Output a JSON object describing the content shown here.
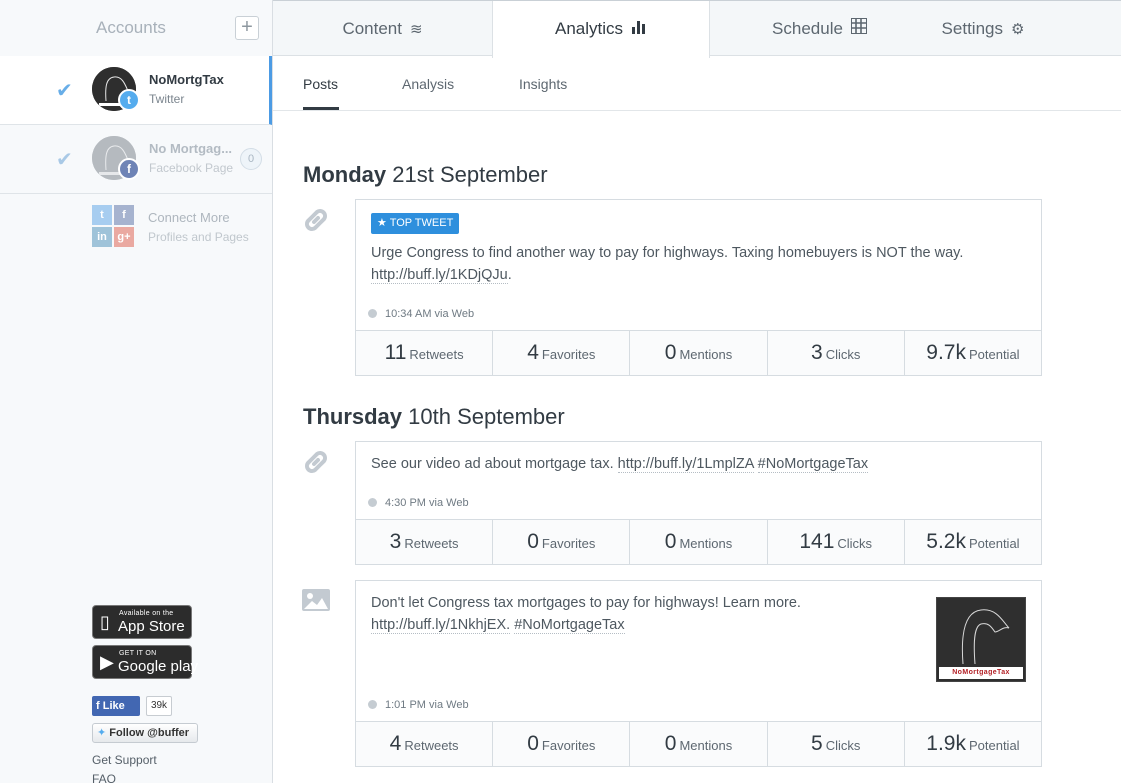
{
  "sidebar": {
    "title": "Accounts",
    "add_label": "+",
    "accounts": [
      {
        "name": "NoMortgTax",
        "type": "Twitter",
        "network": "t"
      },
      {
        "name": "No Mortgag...",
        "type": "Facebook Page",
        "network": "f",
        "count": "0"
      }
    ],
    "connect": {
      "title": "Connect More",
      "subtitle": "Profiles and Pages"
    },
    "app_store": {
      "small": "Available on the",
      "big": "App Store"
    },
    "google_play": {
      "small": "GET IT ON",
      "big": "Google play"
    },
    "fb_like": {
      "label": "Like",
      "count": "39k"
    },
    "tw_follow": {
      "label": "Follow @buffer"
    },
    "links": [
      "Get Support",
      "FAQ"
    ]
  },
  "topnav": {
    "tabs": [
      {
        "label": "Content",
        "icon": "layers-icon"
      },
      {
        "label": "Analytics",
        "icon": "bar-chart-icon"
      },
      {
        "label": "Schedule",
        "icon": "calendar-icon"
      },
      {
        "label": "Settings",
        "icon": "gear-icon"
      }
    ]
  },
  "subnav": {
    "tabs": [
      "Posts",
      "Analysis",
      "Insights"
    ]
  },
  "days": [
    {
      "day": "Monday",
      "date": "21st September"
    },
    {
      "day": "Thursday",
      "date": "10th September"
    }
  ],
  "posts": [
    {
      "badge": "TOP TWEET",
      "text": "Urge Congress to find another way to pay for highways. Taxing homebuyers is NOT the way.",
      "link": "http://buff.ly/1KDjQJu",
      "trail": ".",
      "tags": "",
      "time": "10:34 AM via Web",
      "stats": [
        {
          "value": "11",
          "label": "Retweets"
        },
        {
          "value": "4",
          "label": "Favorites"
        },
        {
          "value": "0",
          "label": "Mentions"
        },
        {
          "value": "3",
          "label": "Clicks"
        },
        {
          "value": "9.7k",
          "label": "Potential"
        }
      ]
    },
    {
      "text": "See our video ad about mortgage tax.",
      "link": "http://buff.ly/1LmplZA",
      "tags": "#NoMortgageTax",
      "time": "4:30 PM via Web",
      "stats": [
        {
          "value": "3",
          "label": "Retweets"
        },
        {
          "value": "0",
          "label": "Favorites"
        },
        {
          "value": "0",
          "label": "Mentions"
        },
        {
          "value": "141",
          "label": "Clicks"
        },
        {
          "value": "5.2k",
          "label": "Potential"
        }
      ]
    },
    {
      "text": "Don't let Congress tax mortgages to pay for highways! Learn more.",
      "link": "http://buff.ly/1NkhjEX.",
      "tags": "#NoMortgageTax",
      "time": "1:01 PM via Web",
      "thumb_label": "NoMortgageTax",
      "stats": [
        {
          "value": "4",
          "label": "Retweets"
        },
        {
          "value": "0",
          "label": "Favorites"
        },
        {
          "value": "0",
          "label": "Mentions"
        },
        {
          "value": "5",
          "label": "Clicks"
        },
        {
          "value": "1.9k",
          "label": "Potential"
        }
      ]
    }
  ],
  "colors": {
    "accent": "#4c9be4",
    "badge": "#2e8fdd",
    "twitter": "#55acee",
    "facebook": "#4267b2"
  }
}
